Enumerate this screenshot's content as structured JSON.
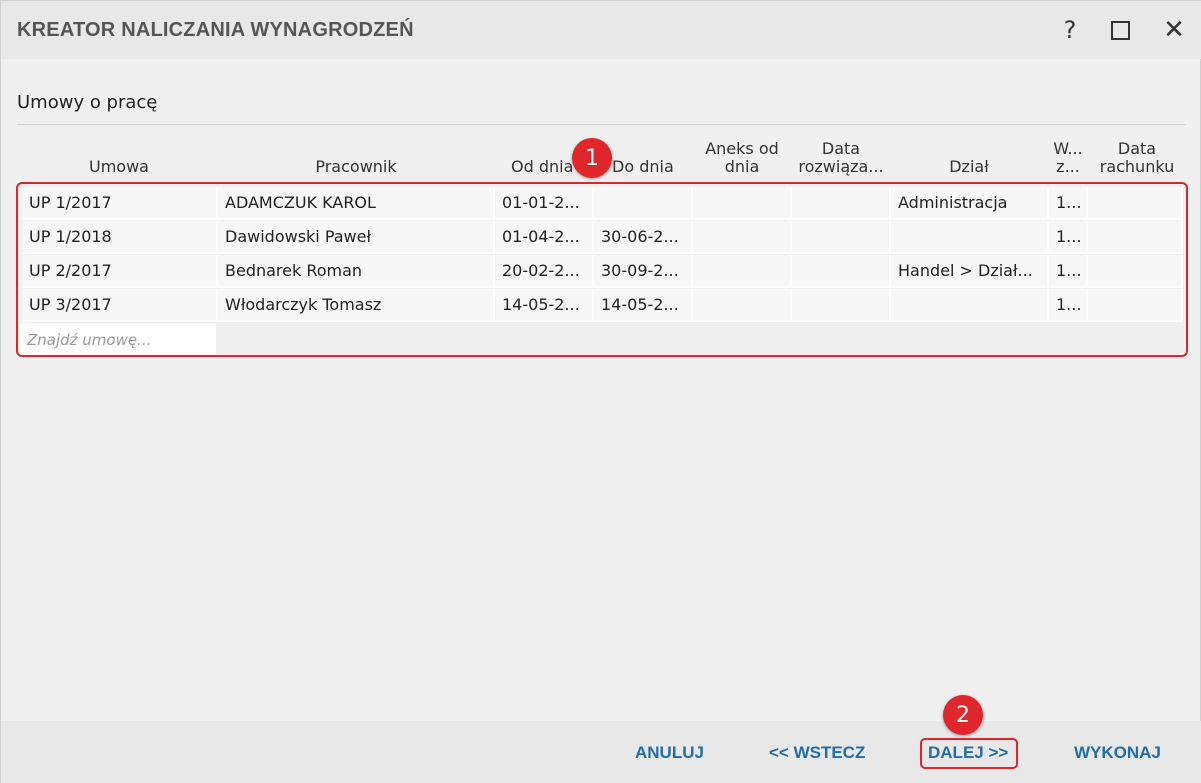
{
  "window": {
    "title": "KREATOR NALICZANIA WYNAGRODZEŃ",
    "help_glyph": "?",
    "close_glyph": "✕"
  },
  "section": {
    "title": "Umowy o pracę"
  },
  "grid": {
    "columns": [
      "Umowa",
      "Pracownik",
      "Od dnia",
      "Do dnia",
      "Aneks od\ndnia",
      "Data\nrozwiąza...",
      "Dział",
      "W...\nz...",
      "Data\nrachunku"
    ],
    "rows": [
      [
        "UP 1/2017",
        "ADAMCZUK KAROL",
        "01-01-2...",
        "",
        "",
        "",
        "Administracja",
        "1...",
        ""
      ],
      [
        "UP 1/2018",
        "Dawidowski Paweł",
        "01-04-2...",
        "30-06-2...",
        "",
        "",
        "",
        "1...",
        ""
      ],
      [
        "UP 2/2017",
        "Bednarek Roman",
        "20-02-2...",
        "30-09-2...",
        "",
        "",
        "Handel > Dział...",
        "1...",
        ""
      ],
      [
        "UP 3/2017",
        "Włodarczyk Tomasz",
        "14-05-2...",
        "14-05-2...",
        "",
        "",
        "",
        "1...",
        ""
      ]
    ],
    "search_placeholder": "Znajdź umowę..."
  },
  "annotations": {
    "badge1": "1",
    "badge2": "2"
  },
  "footer": {
    "cancel_label": "ANULUJ",
    "back_label": "<< WSTECZ",
    "next_label": "DALEJ >>",
    "execute_label": "WYKONAJ"
  },
  "colors": {
    "accent": "#1f6dab",
    "highlight": "#e0262b",
    "titlebar_bg": "#e8e8e8",
    "body_bg": "#f0f0f0"
  }
}
